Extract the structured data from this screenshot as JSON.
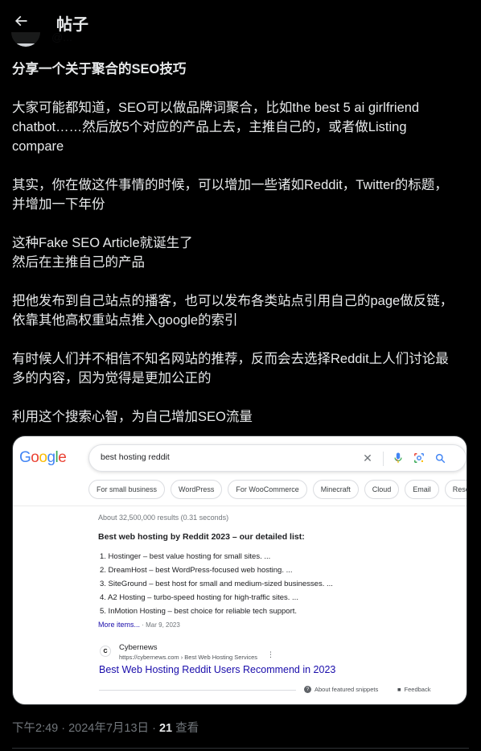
{
  "header": {
    "title": "帖子",
    "behind_handle": "@...",
    "icon": "arrow-left-icon"
  },
  "post": {
    "title": "分享一个关于聚合的SEO技巧",
    "paragraphs": [
      [
        "大家可能都知道，SEO可以做品牌词聚合，比如the best 5 ai girlfriend",
        "chatbot……然后放5个对应的产品上去，主推自己的，或者做Listing",
        "compare"
      ],
      [
        "其实，你在做这件事情的时候，可以增加一些诸如Reddit，Twitter的标题，",
        "并增加一下年份"
      ],
      [
        "这种Fake SEO Article就诞生了",
        "然后在主推自己的产品"
      ],
      [
        "把他发布到自己站点的播客，也可以发布各类站点引用自己的page做反链，",
        "依靠其他高权重站点推入google的索引"
      ],
      [
        "有时候人们并不相信不知名网站的推荐，反而会去选择Reddit上人们讨论最",
        "多的内容，因为觉得是更加公正的"
      ],
      [
        "利用这个搜索心智，为自己增加SEO流量"
      ]
    ]
  },
  "screenshot": {
    "logo_letters": [
      {
        "ch": "G",
        "color": "#4285F4"
      },
      {
        "ch": "o",
        "color": "#EA4335"
      },
      {
        "ch": "o",
        "color": "#FBBC05"
      },
      {
        "ch": "g",
        "color": "#4285F4"
      },
      {
        "ch": "l",
        "color": "#34A853"
      },
      {
        "ch": "e",
        "color": "#EA4335"
      }
    ],
    "query": "best hosting reddit",
    "chips": [
      "For small business",
      "WordPress",
      "For WooCommerce",
      "Minecraft",
      "Cloud",
      "Email",
      "Reseller"
    ],
    "results_count": "About 32,500,000 results (0.31 seconds)",
    "snippet_title": "Best web hosting by Reddit 2023 – our detailed list:",
    "snippet_items": [
      "1. Hostinger – best value hosting for small sites. ...",
      "2. DreamHost – best WordPress-focused web hosting. ...",
      "3. SiteGround – best host for small and medium-sized businesses. ...",
      "4. A2 Hosting – turbo-speed hosting for high-traffic sites. ...",
      "5. InMotion Hosting – best choice for reliable tech support."
    ],
    "more_items": "More items...",
    "more_items_date": " · Mar 9, 2023",
    "source_name": "Cybernews",
    "source_url": "https://cybernews.com › Best Web Hosting Services",
    "result_link": "Best Web Hosting Reddit Users Recommend in 2023",
    "about_snippets": "About featured snippets",
    "feedback": "Feedback"
  },
  "meta": {
    "time_date": "下午2:49 · 2024年7月13日 · ",
    "views_count": "21",
    "views_label": " 查看"
  },
  "colors": {
    "background": "#000000",
    "text": "#e7e9ea",
    "muted": "#71767b",
    "link_blue": "#1a0dab"
  }
}
